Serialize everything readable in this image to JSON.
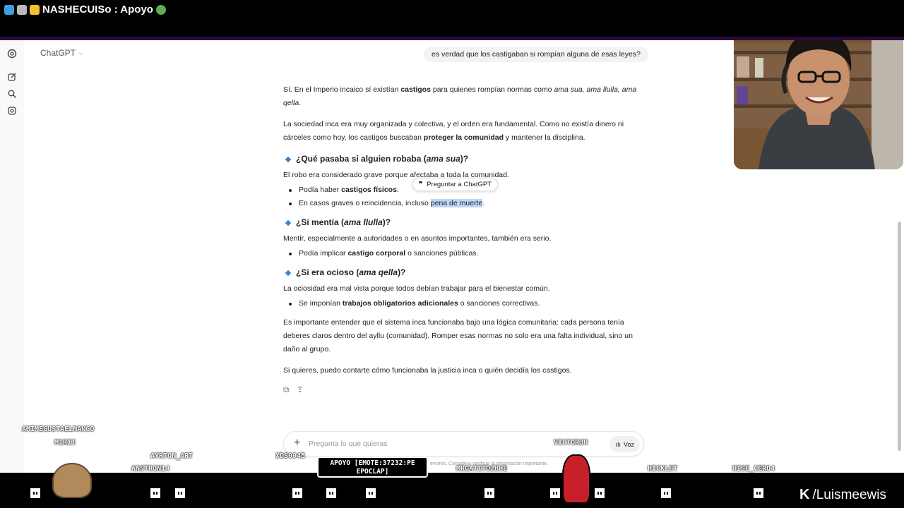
{
  "stream": {
    "title": "NASHECUISo : Apoyo",
    "brand": "/Luismeewis",
    "chat_overlay": [
      "AMIMEGUSTAELMANGO",
      "M1RII",
      "AYRTON_ART",
      "ANSTRON14",
      "XDS0045",
      "VICTOR3N",
      "MRGATITO2BHE",
      "HICKLET",
      "NISE_CERO4"
    ],
    "speech_bubble": "APOYO [EMOTE:37232:PE EPOCLAP]"
  },
  "chatgpt": {
    "model_label": "ChatGPT",
    "user_message": "es verdad que los castigaban si rompían alguna de esas leyes?",
    "ask_popup": "Preguntar a ChatGPT",
    "answer": {
      "p1_a": "Sí. En el Imperio incaico sí existían ",
      "p1_b": "castigos",
      "p1_c": " para quienes rompían normas como ",
      "p1_d": "ama sua, ama llulla, ama qella",
      "p1_e": ".",
      "p2_a": "La sociedad inca era muy organizada y colectiva, y el orden era fundamental. Como no existía dinero ni cárceles como hoy, los castigos buscaban ",
      "p2_b": "proteger la comunidad",
      "p2_c": " y mantener la disciplina.",
      "h1_a": "¿Qué pasaba si alguien robaba (",
      "h1_b": "ama sua",
      "h1_c": ")?",
      "h1_p": "El robo era considerado grave porque afectaba a toda la comunidad.",
      "h1_li1_a": "Podía haber ",
      "h1_li1_b": "castigos físicos",
      "h1_li1_c": ".",
      "h1_li2_a": "En casos graves o reincidencia, incluso ",
      "h1_li2_b": "pena de muerte",
      "h1_li2_c": ".",
      "h2_a": "¿Si mentía (",
      "h2_b": "ama llulla",
      "h2_c": ")?",
      "h2_p": "Mentir, especialmente a autoridades o en asuntos importantes, también era serio.",
      "h2_li1_a": "Podía implicar ",
      "h2_li1_b": "castigo corporal",
      "h2_li1_c": " o sanciones públicas.",
      "h3_a": "¿Si era ocioso (",
      "h3_b": "ama qella",
      "h3_c": ")?",
      "h3_p": "La ociosidad era mal vista porque todos debían trabajar para el bienestar común.",
      "h3_li1_a": "Se imponían ",
      "h3_li1_b": "trabajos obligatorios adicionales",
      "h3_li1_c": " o sanciones correctivas.",
      "p3": "Es importante entender que el sistema inca funcionaba bajo una lógica comunitaria: cada persona tenía deberes claros dentro del ayllu (comunidad). Romper esas normas no solo era una falta individual, sino un daño al grupo.",
      "p4": "Si quieres, puedo contarte cómo funcionaba la justicia inca o quién decidía los castigos."
    },
    "composer": {
      "placeholder": "Pregunta lo que quieras",
      "voice_label": "Voz"
    },
    "disclaimer": "errores. Considera verificar la información importante."
  },
  "colors": {
    "accent_blue": "#3b82c4",
    "highlight": "#bcd8f6"
  }
}
